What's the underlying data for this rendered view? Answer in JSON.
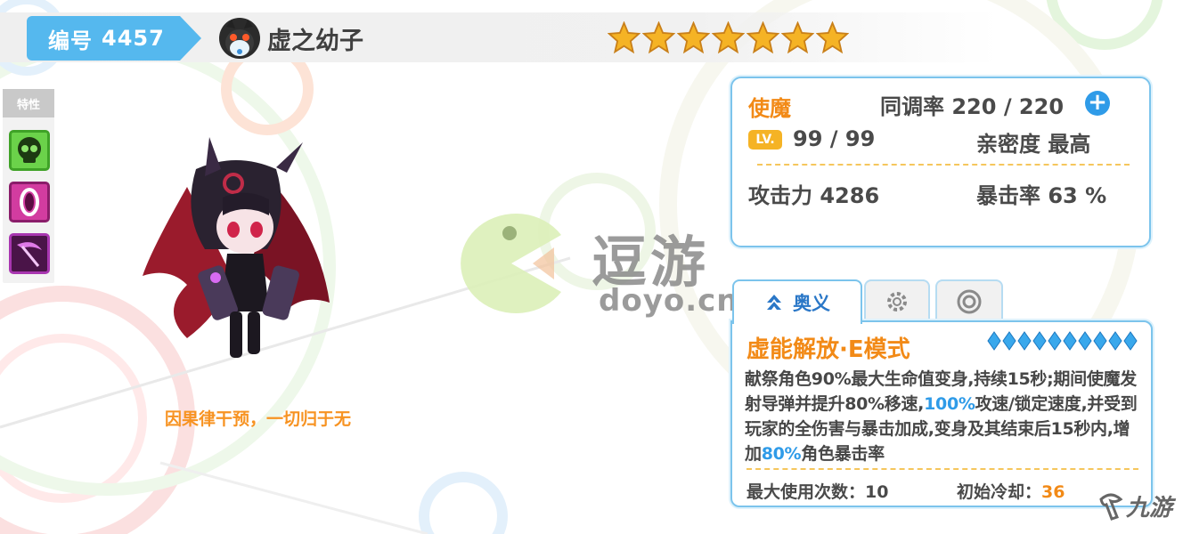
{
  "header": {
    "id_label": "编号",
    "id_number": "4457",
    "pet_name": "虚之幼子",
    "star_count": 7,
    "star_color": "#f5b325"
  },
  "traits": {
    "title": "特性",
    "items": [
      {
        "icon": "skull-icon",
        "color": "#6bd24a"
      },
      {
        "icon": "zero-orb-icon",
        "color": "#d23ca0"
      },
      {
        "icon": "scythe-icon",
        "color": "#a836b0"
      }
    ]
  },
  "character": {
    "quote": "因果律干预，一切归于无"
  },
  "watermark": {
    "cn": "逗游",
    "en": "doyo.cn"
  },
  "stats": {
    "role": "使魔",
    "sync_label": "同调率",
    "sync_value": "220 / 220",
    "lv_badge": "LV.",
    "level": "99 / 99",
    "affinity_label": "亲密度",
    "affinity_value": "最高",
    "atk_label": "攻击力",
    "atk_value": "4286",
    "crit_label": "暴击率",
    "crit_value": "63 %"
  },
  "tabs": [
    {
      "label": "奥义",
      "icon": "ougi-arrow-icon",
      "active": true
    },
    {
      "label": "",
      "icon": "gear-icon",
      "active": false
    },
    {
      "label": "",
      "icon": "ring-icon",
      "active": false
    }
  ],
  "skill": {
    "name": "虚能解放·E模式",
    "gem_count": 10,
    "desc_part1": "献祭角色90%最大生命值变身,持续15秒;期间使魔发射导弹并提升80%移速,",
    "desc_hl1": "100%",
    "desc_part2": "攻速/锁定速度,并受到玩家的全伤害与暴击加成,变身及其结束后15秒内,增加",
    "desc_hl2": "80%",
    "desc_part3": "角色暴击率",
    "uses_label": "最大使用次数：",
    "uses_value": "10",
    "cooldown_label": "初始冷却：",
    "cooldown_value": "36"
  },
  "corner_logo": {
    "text": "九游"
  },
  "colors": {
    "accent_blue": "#55b8ee",
    "accent_orange": "#f28a17",
    "highlight_blue": "#2f9be8"
  }
}
